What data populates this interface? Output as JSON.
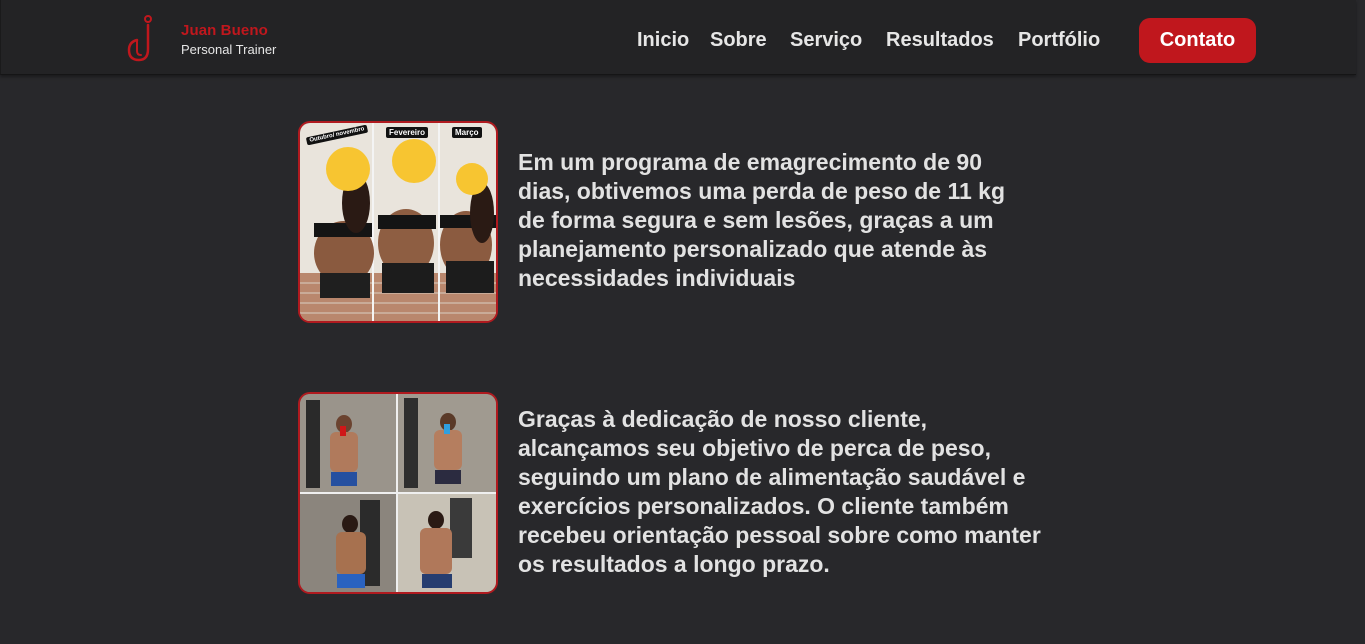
{
  "brand": {
    "name": "Juan Bueno",
    "subtitle": "Personal Trainer",
    "accent_color": "#c0171d"
  },
  "nav": {
    "items": [
      "Inicio",
      "Sobre",
      "Serviço",
      "Resultados",
      "Portfólio"
    ],
    "contact_label": "Contato"
  },
  "results": [
    {
      "photo_labels": [
        "Outubro/ novembro",
        "Fevereiro",
        "Março"
      ],
      "text": "Em um programa de emagrecimento de 90 dias, obtivemos uma perda de peso de 11 kg de forma segura e sem lesões, graças a um planejamento personalizado que atende às necessidades individuais"
    },
    {
      "text": "Graças à dedicação de nosso cliente, alcançamos seu objetivo de perca de peso, seguindo um plano de alimentação saudável e exercícios personalizados. O cliente também recebeu orientação pessoal sobre como manter os resultados a longo prazo."
    }
  ]
}
